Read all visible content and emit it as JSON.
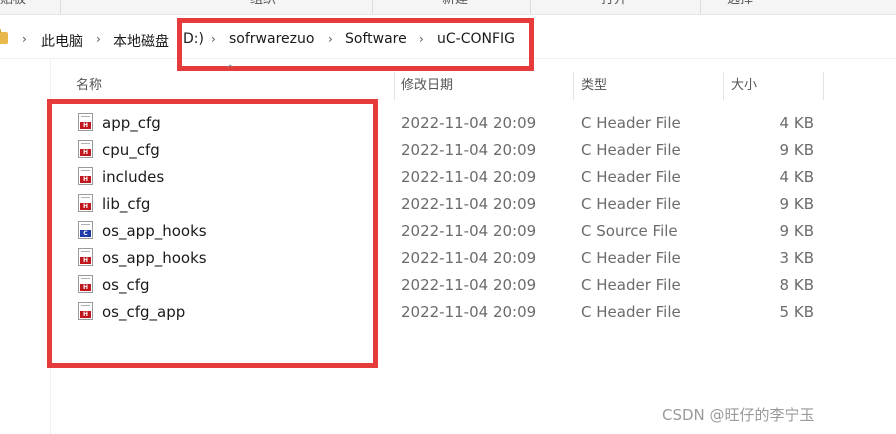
{
  "ribbon": {
    "groups": [
      "贴板",
      "组织",
      "新建",
      "打开",
      "选择"
    ]
  },
  "breadcrumb": [
    "此电脑",
    "本地磁盘",
    "D:)",
    "sofrwarezuo",
    "Software",
    "uC-CONFIG"
  ],
  "columns": {
    "name": "名称",
    "modified": "修改日期",
    "type": "类型",
    "size": "大小"
  },
  "files": [
    {
      "name": "app_cfg",
      "modified": "2022-11-04 20:09",
      "type": "C Header File",
      "size": "4 KB",
      "icon": "c-header-file-icon"
    },
    {
      "name": "cpu_cfg",
      "modified": "2022-11-04 20:09",
      "type": "C Header File",
      "size": "9 KB",
      "icon": "c-header-file-icon"
    },
    {
      "name": "includes",
      "modified": "2022-11-04 20:09",
      "type": "C Header File",
      "size": "4 KB",
      "icon": "c-header-file-icon"
    },
    {
      "name": "lib_cfg",
      "modified": "2022-11-04 20:09",
      "type": "C Header File",
      "size": "9 KB",
      "icon": "c-header-file-icon"
    },
    {
      "name": "os_app_hooks",
      "modified": "2022-11-04 20:09",
      "type": "C Source File",
      "size": "9 KB",
      "icon": "c-source-file-icon"
    },
    {
      "name": "os_app_hooks",
      "modified": "2022-11-04 20:09",
      "type": "C Header File",
      "size": "3 KB",
      "icon": "c-header-file-icon"
    },
    {
      "name": "os_cfg",
      "modified": "2022-11-04 20:09",
      "type": "C Header File",
      "size": "8 KB",
      "icon": "c-header-file-icon"
    },
    {
      "name": "os_cfg_app",
      "modified": "2022-11-04 20:09",
      "type": "C Header File",
      "size": "5 KB",
      "icon": "c-header-file-icon"
    }
  ],
  "watermark": "CSDN @旺仔的李宁玉",
  "colors": {
    "highlight_box": "#e53b3b",
    "header_icon_badge": "#c0161e",
    "source_icon_badge": "#1d3aa8"
  }
}
